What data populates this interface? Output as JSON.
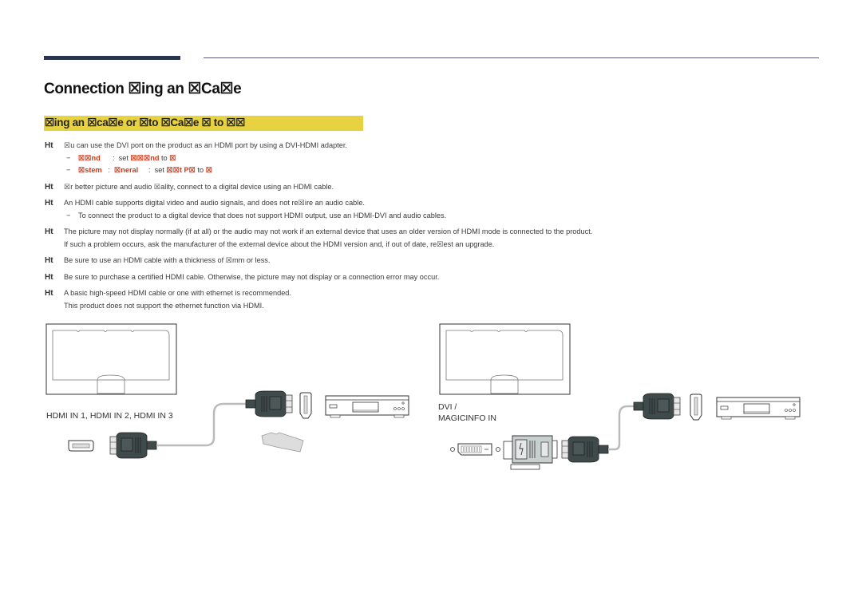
{
  "header": {
    "title": "Connection ☒ing an ☒Ca☒e"
  },
  "section": {
    "title": "☒ing an ☒ca☒e or ☒to ☒Ca☒e ☒ to ☒☒"
  },
  "notes": [
    {
      "bullet": "Ht",
      "text": "☒u can use the DVI port on the product as an HDMI port by using a DVI-HDMI adapter.",
      "subs": [
        {
          "dash": "−",
          "parts": [
            {
              "text": "☒☒nd",
              "red": true
            },
            {
              "text": "      :  set ",
              "red": false
            },
            {
              "text": "☒☒☒nd",
              "red": true
            },
            {
              "text": " to ",
              "red": false
            },
            {
              "text": "☒",
              "red": true
            }
          ]
        },
        {
          "dash": "−",
          "parts": [
            {
              "text": "☒stem",
              "red": true
            },
            {
              "text": "   :  ",
              "red": false
            },
            {
              "text": "☒neral",
              "red": true
            },
            {
              "text": "     :  set ",
              "red": false
            },
            {
              "text": "☒☒t P☒",
              "red": true
            },
            {
              "text": " to ",
              "red": false
            },
            {
              "text": "☒",
              "red": true
            }
          ]
        }
      ]
    },
    {
      "bullet": "Ht",
      "text": "☒r better picture and audio ☒ality, connect to a digital device using an HDMI cable.",
      "subs": []
    },
    {
      "bullet": "Ht",
      "text": "An HDMI cable supports digital video and audio signals, and does not re☒ire an audio cable.",
      "subs": [
        {
          "dash": "−",
          "parts": [
            {
              "text": "To connect the product to a digital device that does not support HDMI output, use an HDMI-DVI and audio cables.",
              "red": false
            }
          ]
        }
      ]
    },
    {
      "bullet": "Ht",
      "text": "The picture may not display normally (if at all) or the audio may not work if an external device that uses an older version of HDMI mode is connected to the product.",
      "text2": "If such a problem occurs, ask the manufacturer of the external device about the HDMI version and, if out of date, re☒est an upgrade.",
      "subs": []
    },
    {
      "bullet": "Ht",
      "text": "Be sure to use an HDMI cable with a thickness of ☒mm or less.",
      "subs": []
    },
    {
      "bullet": "Ht",
      "text": "Be sure to purchase a certified HDMI cable. Otherwise, the picture may not display or a connection error may occur.",
      "subs": []
    },
    {
      "bullet": "Ht",
      "text": "A basic high-speed HDMI cable or one with ethernet is recommended.",
      "text2": "This product does not support the ethernet function via HDMI.",
      "subs": []
    }
  ],
  "diagram": {
    "left_port_label": "HDMI IN 1, HDMI IN 2, HDMI IN 3",
    "right_port_label_line1": "DVI /",
    "right_port_label_line2": "MAGICINFO IN"
  },
  "colors": {
    "highlight": "#e7d341",
    "accent_red": "#d23a1a",
    "header_bar": "#2a3350",
    "connector": "#3f4a4a"
  }
}
